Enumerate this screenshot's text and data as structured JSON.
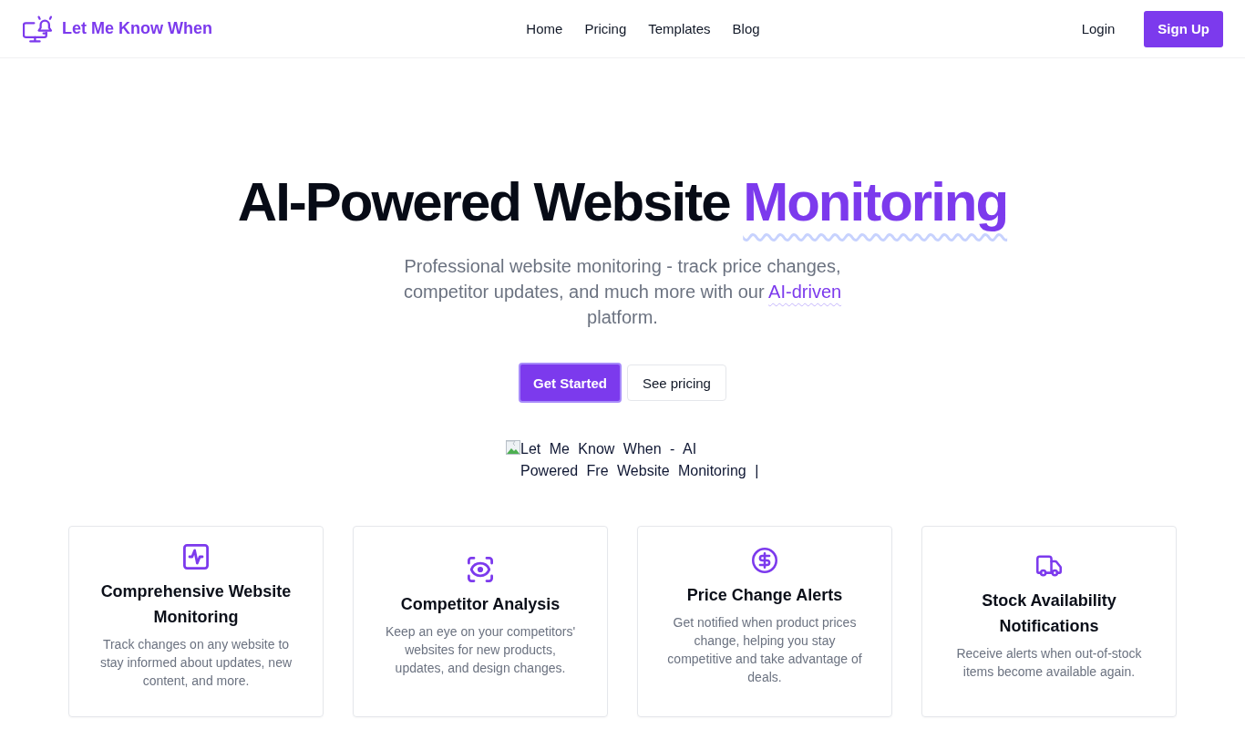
{
  "header": {
    "logo": "Let Me Know When",
    "nav": [
      "Home",
      "Pricing",
      "Templates",
      "Blog"
    ],
    "login": "Login",
    "signup": "Sign Up"
  },
  "hero": {
    "title": "AI-Powered Website",
    "title_highlight": "Monitoring",
    "subtitle_before": "Professional website monitoring - track price changes, competitor updates, and much more with our",
    "subtitle_highlight": "AI-driven",
    "subtitle_after": "platform.",
    "buttons": [
      {
        "label": "Get Started",
        "kind": "primary"
      },
      {
        "label": "See pricing",
        "kind": "secondary"
      }
    ],
    "image_alt": "Let Me Know When - AI Powered Fre Website Monitoring |"
  },
  "features": [
    {
      "title": "Comprehensive Website Monitoring",
      "description": "Track changes on any website to stay informed about updates, new content, and more."
    },
    {
      "title": "Competitor Analysis",
      "description": "Keep an eye on your competitors' websites for new products, updates, and design changes."
    },
    {
      "title": "Price Change Alerts",
      "description": "Get notified when product prices change, helping you stay competitive and take advantage of deals."
    },
    {
      "title": "Stock Availability Notifications",
      "description": "Receive alerts when out-of-stock items become available again."
    }
  ]
}
